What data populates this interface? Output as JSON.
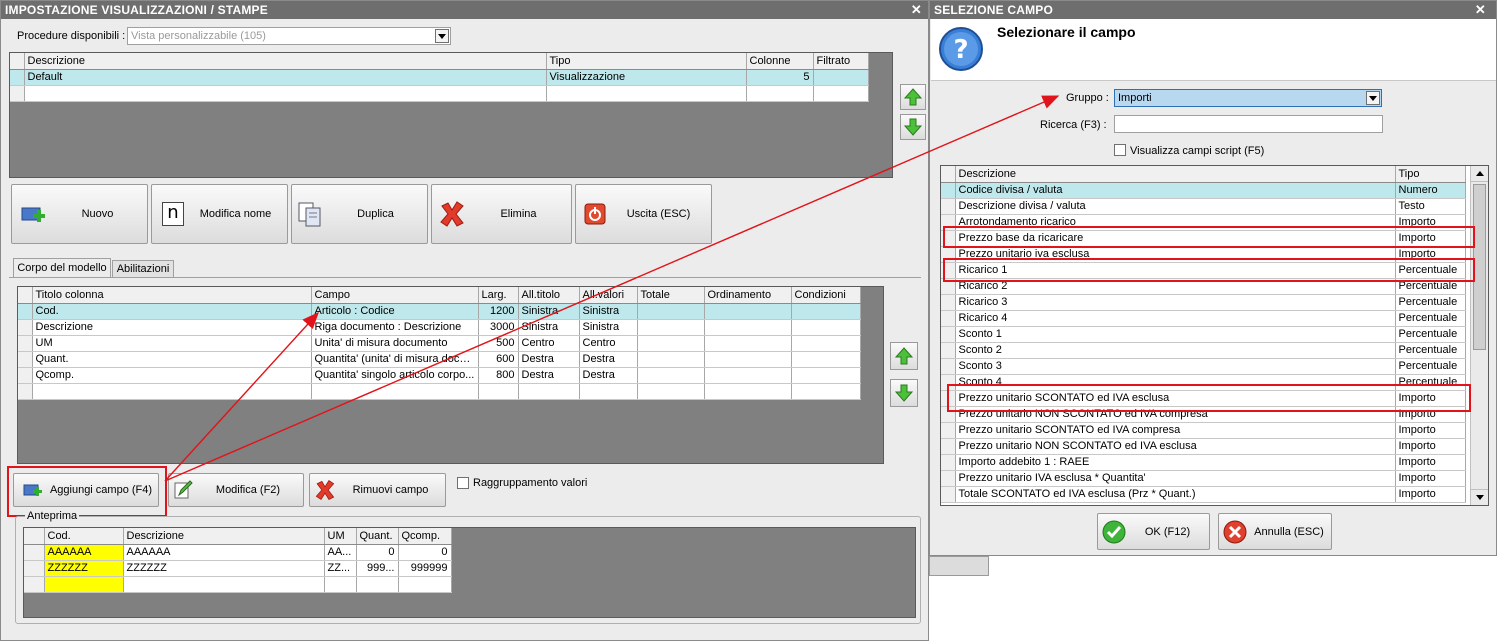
{
  "left_window": {
    "title": "IMPOSTAZIONE VISUALIZZAZIONI / STAMPE",
    "procedure_label": "Procedure disponibili :",
    "procedure_value": "Vista personalizzabile (105)",
    "views_table": {
      "headers": [
        "Descrizione",
        "Tipo",
        "Colonne",
        "Filtrato"
      ],
      "rows": [
        {
          "descrizione": "Default",
          "tipo": "Visualizzazione",
          "colonne": "5",
          "filtrato": ""
        }
      ]
    },
    "buttons": {
      "nuovo": "Nuovo",
      "modifica_nome": "Modifica nome",
      "duplica": "Duplica",
      "elimina": "Elimina",
      "uscita": "Uscita (ESC)"
    },
    "tabs": [
      "Corpo del modello",
      "Abilitazioni"
    ],
    "columns_table": {
      "headers": [
        "Titolo colonna",
        "Campo",
        "Larg.",
        "All.titolo",
        "All.valori",
        "Totale",
        "Ordinamento",
        "Condizioni"
      ],
      "rows": [
        {
          "titolo": "Cod.",
          "campo": "Articolo : Codice",
          "larg": "1200",
          "all_titolo": "Sinistra",
          "all_valori": "Sinistra"
        },
        {
          "titolo": "Descrizione",
          "campo": "Riga documento : Descrizione",
          "larg": "3000",
          "all_titolo": "Sinistra",
          "all_valori": "Sinistra"
        },
        {
          "titolo": "UM",
          "campo": "Unita' di misura documento",
          "larg": "500",
          "all_titolo": "Centro",
          "all_valori": "Centro"
        },
        {
          "titolo": "Quant.",
          "campo": "Quantita' (unita' di misura docu...",
          "larg": "600",
          "all_titolo": "Destra",
          "all_valori": "Destra"
        },
        {
          "titolo": "Qcomp.",
          "campo": "Quantita' singolo articolo corpo...",
          "larg": "800",
          "all_titolo": "Destra",
          "all_valori": "Destra"
        }
      ]
    },
    "field_buttons": {
      "aggiungi": "Aggiungi campo (F4)",
      "modifica": "Modifica (F2)",
      "rimuovi": "Rimuovi campo"
    },
    "raggruppamento_label": "Raggruppamento valori",
    "anteprima_label": "Anteprima",
    "preview_table": {
      "headers": [
        "Cod.",
        "Descrizione",
        "UM",
        "Quant.",
        "Qcomp."
      ],
      "rows": [
        {
          "cod": "AAAAAA",
          "descrizione": "AAAAAA",
          "um": "AA...",
          "quant": "0",
          "qcomp": "0"
        },
        {
          "cod": "ZZZZZZ",
          "descrizione": "ZZZZZZ",
          "um": "ZZ...",
          "quant": "999...",
          "qcomp": "999999"
        }
      ]
    }
  },
  "right_window": {
    "title": "SELEZIONE CAMPO",
    "heading": "Selezionare il campo",
    "gruppo_label": "Gruppo :",
    "gruppo_value": "Importi",
    "ricerca_label": "Ricerca (F3) :",
    "ricerca_value": "",
    "script_label": "Visualizza campi script (F5)",
    "fields_table": {
      "headers": [
        "Descrizione",
        "Tipo"
      ],
      "rows": [
        {
          "descrizione": "Codice divisa / valuta",
          "tipo": "Numero"
        },
        {
          "descrizione": "Descrizione divisa / valuta",
          "tipo": "Testo"
        },
        {
          "descrizione": "Arrotondamento ricarico",
          "tipo": "Importo"
        },
        {
          "descrizione": "Prezzo base da ricaricare",
          "tipo": "Importo"
        },
        {
          "descrizione": "Prezzo unitario iva esclusa",
          "tipo": "Importo"
        },
        {
          "descrizione": "Ricarico 1",
          "tipo": "Percentuale"
        },
        {
          "descrizione": "Ricarico 2",
          "tipo": "Percentuale"
        },
        {
          "descrizione": "Ricarico 3",
          "tipo": "Percentuale"
        },
        {
          "descrizione": "Ricarico 4",
          "tipo": "Percentuale"
        },
        {
          "descrizione": "Sconto 1",
          "tipo": "Percentuale"
        },
        {
          "descrizione": "Sconto 2",
          "tipo": "Percentuale"
        },
        {
          "descrizione": "Sconto 3",
          "tipo": "Percentuale"
        },
        {
          "descrizione": "Sconto 4",
          "tipo": "Percentuale"
        },
        {
          "descrizione": "Prezzo unitario SCONTATO ed IVA esclusa",
          "tipo": "Importo"
        },
        {
          "descrizione": "Prezzo unitario NON SCONTATO ed IVA compresa",
          "tipo": "Importo"
        },
        {
          "descrizione": "Prezzo unitario SCONTATO ed IVA compresa",
          "tipo": "Importo"
        },
        {
          "descrizione": "Prezzo unitario NON SCONTATO ed IVA esclusa",
          "tipo": "Importo"
        },
        {
          "descrizione": "Importo addebito 1 : RAEE",
          "tipo": "Importo"
        },
        {
          "descrizione": "Prezzo unitario IVA esclusa * Quantita'",
          "tipo": "Importo"
        },
        {
          "descrizione": "Totale SCONTATO ed IVA esclusa (Prz * Quant.)",
          "tipo": "Importo"
        }
      ]
    },
    "ok_label": "OK (F12)",
    "annulla_label": "Annulla (ESC)"
  },
  "colors": {
    "title_bar": "#6e6e6e",
    "selection_row": "#bfe8ec",
    "highlight": "#e0141a",
    "preview_code": "#ffff00"
  }
}
